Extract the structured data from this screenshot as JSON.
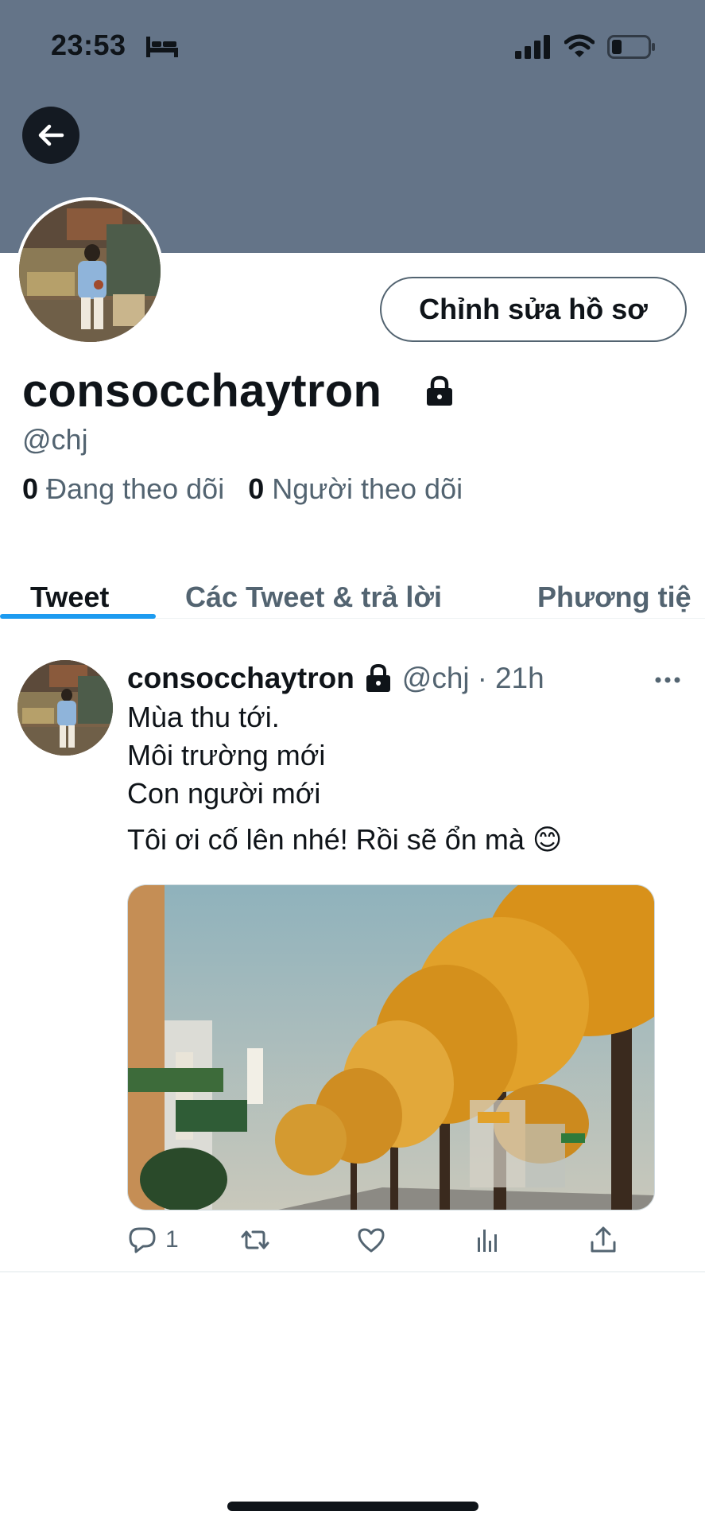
{
  "status_bar": {
    "time": "23:53"
  },
  "colors": {
    "banner": "#647488",
    "accent": "#1d9bf0",
    "secondary_text": "#536471"
  },
  "profile": {
    "edit_button": "Chỉnh sửa hồ sơ",
    "display_name": "consocchaytron",
    "handle": "@chj",
    "following_count": "0",
    "following_label": "Đang theo dõi",
    "followers_count": "0",
    "followers_label": "Người theo dõi"
  },
  "tabs": [
    {
      "label": "Tweet",
      "active": true
    },
    {
      "label": "Các Tweet & trả lời",
      "active": false
    },
    {
      "label": "Phương tiệ",
      "active": false
    }
  ],
  "tweet": {
    "name": "consocchaytron",
    "handle": "@chj",
    "separator": "·",
    "time": "21h",
    "lines": [
      "Mùa thu tới.",
      "Môi trường mới",
      "Con người mới",
      "Tôi ơi cố lên nhé! Rồi sẽ ổn mà 😊"
    ],
    "reply_count": "1"
  },
  "icons": [
    "arrow-left-icon",
    "lock-icon",
    "more-icon",
    "reply-icon",
    "retweet-icon",
    "like-icon",
    "analytics-icon",
    "share-icon"
  ]
}
